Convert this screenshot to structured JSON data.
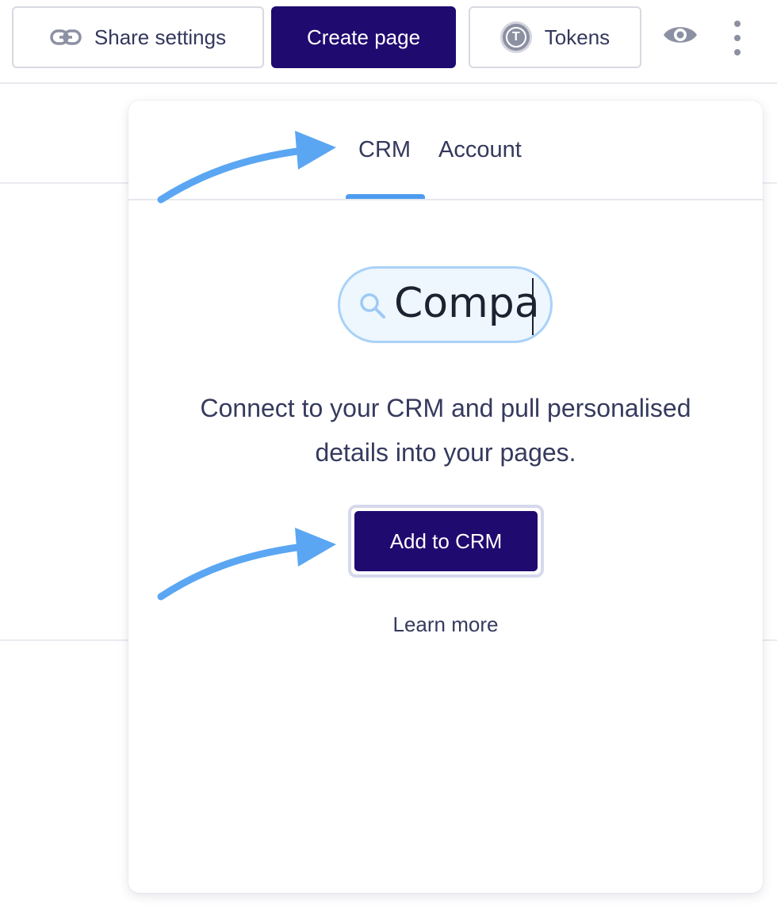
{
  "toolbar": {
    "share_label": "Share settings",
    "create_label": "Create page",
    "tokens_label": "Tokens",
    "token_letter": "T"
  },
  "panel": {
    "tabs": [
      {
        "label": "CRM",
        "active": true
      },
      {
        "label": "Account",
        "active": false
      }
    ],
    "search": {
      "value": "Compa"
    },
    "description": "Connect to your CRM and pull personalised details into your pages.",
    "cta_label": "Add to CRM",
    "learn_more_label": "Learn more"
  },
  "icons": {
    "share": "link-icon",
    "tokens": "token-icon",
    "preview": "eye-icon",
    "more": "more-vertical-icon",
    "search": "search-icon",
    "annotation": "arrow-icon"
  },
  "colors": {
    "primary": "#1f0a6f",
    "accent": "#4d9cf0",
    "text": "#363a5e",
    "icon_gray": "#8c90a3",
    "annotation_arrow": "#5aa6f2"
  }
}
